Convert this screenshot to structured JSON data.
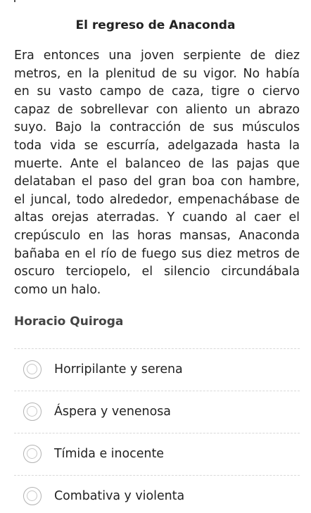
{
  "question": {
    "title": "El regreso de Anaconda",
    "passage": "Era entonces una joven serpiente de diez metros, en la plenitud de su vigor. No había en su vasto campo de caza, tigre o ciervo capaz de sobrellevar con aliento un abrazo suyo. Bajo la contracción de sus músculos toda vida se escurría, adelgazada hasta la muerte. Ante el balanceo de las pajas que delataban el paso del gran boa con hambre, el juncal, todo alrededor, empenachábase de altas orejas aterradas. Y cuando al caer el crepúsculo en las horas mansas, Anaconda bañaba en el río de fuego sus diez metros de oscuro terciopelo, el silencio circundábala como un halo.",
    "author": "Horacio Quiroga"
  },
  "options": [
    {
      "label": "Horripilante y serena",
      "selected": false
    },
    {
      "label": "Áspera y venenosa",
      "selected": false
    },
    {
      "label": "Tímida e inocente",
      "selected": false
    },
    {
      "label": "Combativa y violenta",
      "selected": false
    }
  ]
}
